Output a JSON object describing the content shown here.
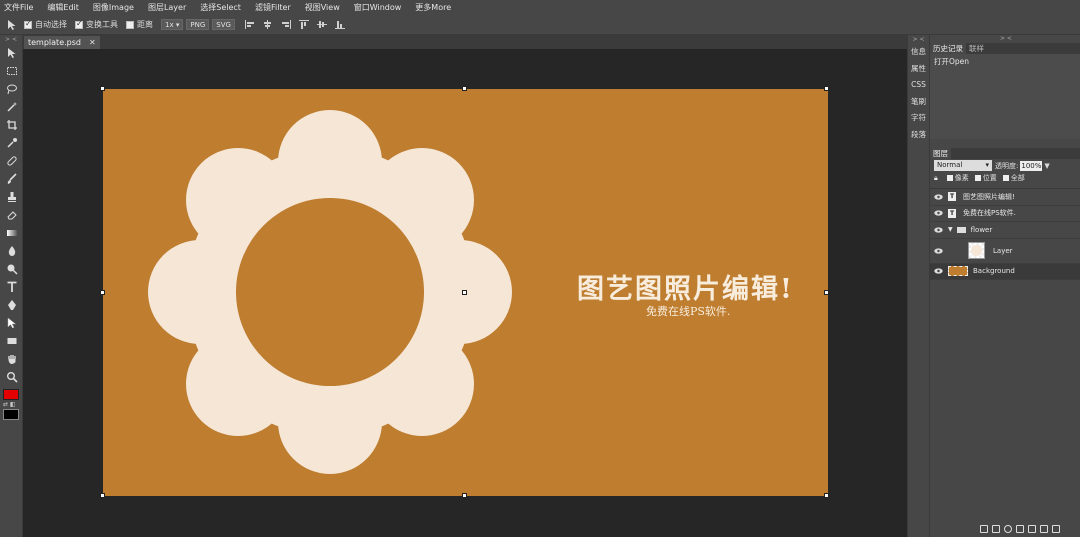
{
  "menu": [
    "文件File",
    "编辑Edit",
    "图像Image",
    "图层Layer",
    "选择Select",
    "滤镜Filter",
    "视图View",
    "窗口Window",
    "更多More"
  ],
  "options": {
    "auto_select": "自动选择",
    "transform_tools": "变换工具",
    "distance": "距离",
    "zoom": "1x",
    "png": "PNG",
    "svg": "SVG"
  },
  "document": {
    "tab_name": "template.psd",
    "close": "✕",
    "headline": "图艺图照片编辑!",
    "subline": "免费在线PS软件."
  },
  "colors": {
    "foreground": "#e30000",
    "background": "#000000",
    "artboard": "#be7d2f",
    "flower": "#f5e6d6"
  },
  "side_panel": {
    "collapse": "> <",
    "items": [
      "信息",
      "属性",
      "CSS",
      "笔刷",
      "字符",
      "段落"
    ]
  },
  "right_panel": {
    "collapse": "> <",
    "tabs": [
      "历史记录",
      "联样"
    ],
    "history": [
      "打开Open"
    ],
    "layers_tab": "图层",
    "blend_mode": "Normal",
    "opacity_label": "透明度:",
    "opacity_value": "100%",
    "lock_labels": [
      "像素",
      "位置",
      "全部"
    ],
    "layers": [
      {
        "name": "图艺图照片编辑!",
        "type": "text"
      },
      {
        "name": "免费在线PS软件.",
        "type": "text"
      },
      {
        "name": "flower",
        "type": "folder"
      },
      {
        "name": "Layer",
        "type": "image"
      },
      {
        "name": "Background",
        "type": "background"
      }
    ]
  }
}
